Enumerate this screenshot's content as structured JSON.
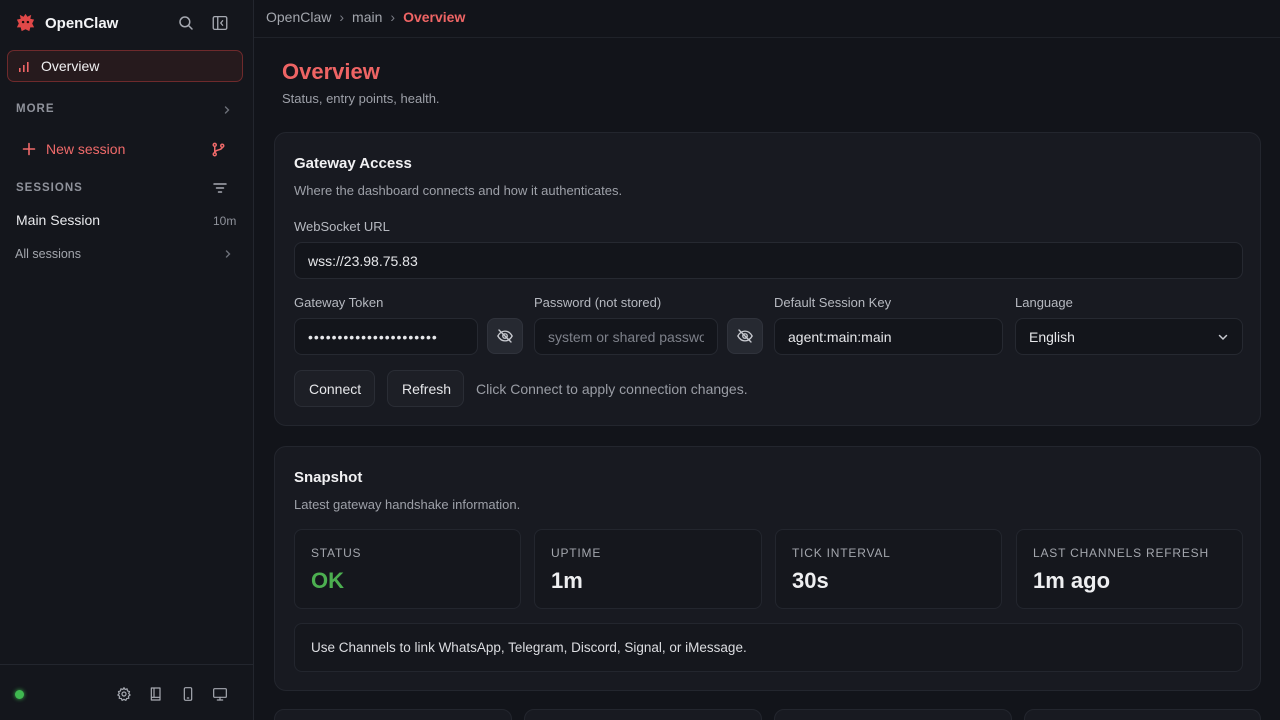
{
  "app": {
    "name": "OpenClaw",
    "accent_color": "#ef6565",
    "ok_color": "#4caf50"
  },
  "sidebar": {
    "nav_overview": "Overview",
    "more_label": "MORE",
    "new_session": "New session",
    "sessions_label": "SESSIONS",
    "sessions": [
      {
        "name": "Main Session",
        "age": "10m"
      }
    ],
    "all_sessions": "All sessions",
    "connection_status": "connected"
  },
  "breadcrumb": [
    "OpenClaw",
    "main",
    "Overview"
  ],
  "page": {
    "title": "Overview",
    "subtitle": "Status, entry points, health."
  },
  "gateway": {
    "title": "Gateway Access",
    "subtitle": "Where the dashboard connects and how it authenticates.",
    "ws_label": "WebSocket URL",
    "ws_value": "wss://23.98.75.83",
    "token_label": "Gateway Token",
    "token_value": "••••••••••••••••••••••",
    "password_label": "Password (not stored)",
    "password_placeholder": "system or shared password",
    "session_key_label": "Default Session Key",
    "session_key_value": "agent:main:main",
    "language_label": "Language",
    "language_value": "English",
    "connect_label": "Connect",
    "refresh_label": "Refresh",
    "hint": "Click Connect to apply connection changes."
  },
  "snapshot": {
    "title": "Snapshot",
    "subtitle": "Latest gateway handshake information.",
    "stats": [
      {
        "label": "STATUS",
        "value": "OK"
      },
      {
        "label": "UPTIME",
        "value": "1m"
      },
      {
        "label": "TICK INTERVAL",
        "value": "30s"
      },
      {
        "label": "LAST CHANNELS REFRESH",
        "value": "1m ago"
      }
    ],
    "note": "Use Channels to link WhatsApp, Telegram, Discord, Signal, or iMessage."
  }
}
